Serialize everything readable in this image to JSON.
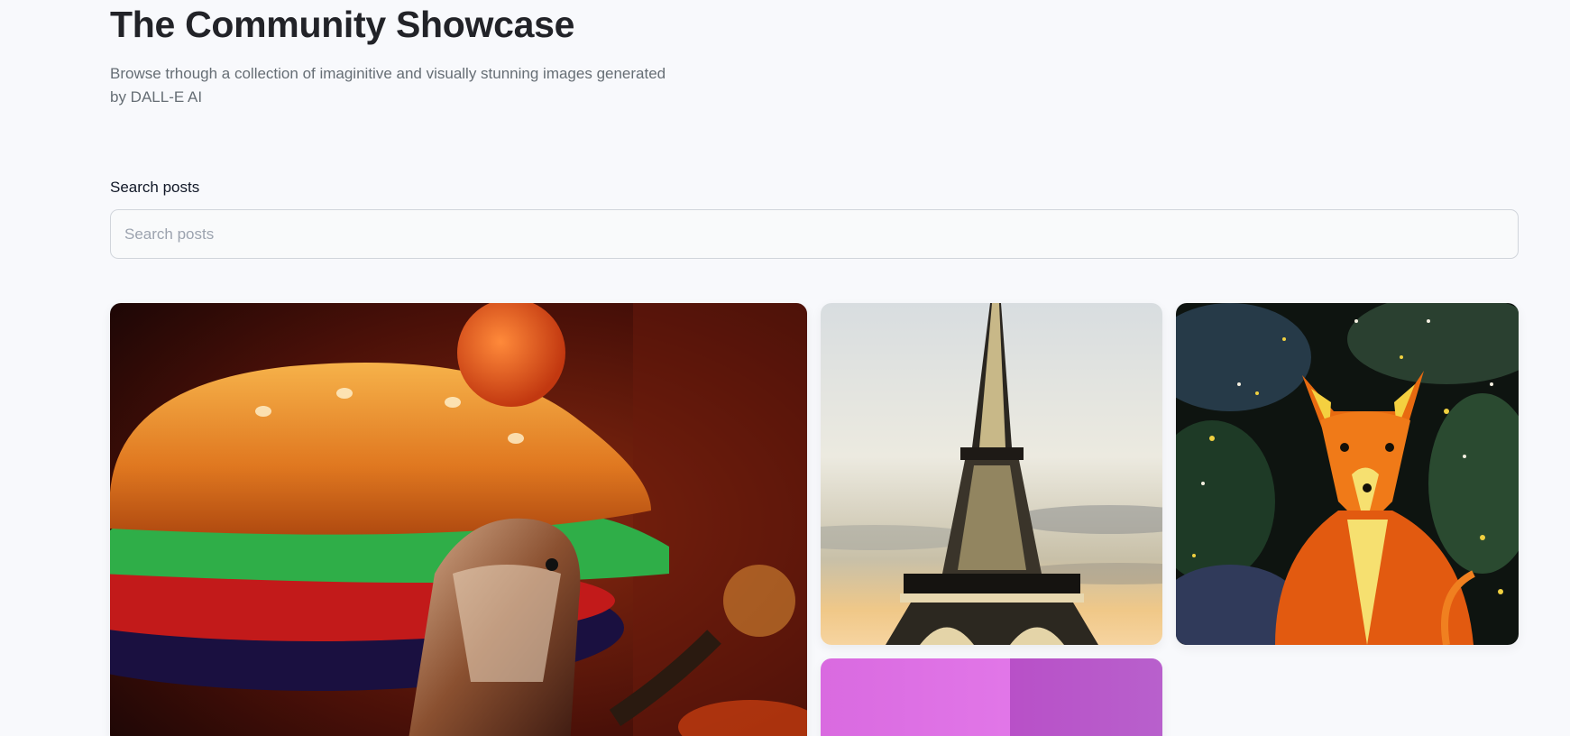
{
  "header": {
    "title": "The Community Showcase",
    "subtitle": "Browse trhough a collection of imaginitive and visually stunning images generated by DALL-E AI"
  },
  "search": {
    "label": "Search posts",
    "placeholder": "Search posts",
    "value": ""
  },
  "colors": {
    "background": "#f8f9fc",
    "title": "#222328",
    "subtitle": "#666e75",
    "input_border": "#d1d5db"
  },
  "gallery": {
    "cards": [
      {
        "subject": "dog-hamburger-painting"
      },
      {
        "subject": "eiffel-tower-sunset"
      },
      {
        "subject": "fox-starry-painting"
      },
      {
        "subject": "pink-abstract"
      }
    ]
  }
}
